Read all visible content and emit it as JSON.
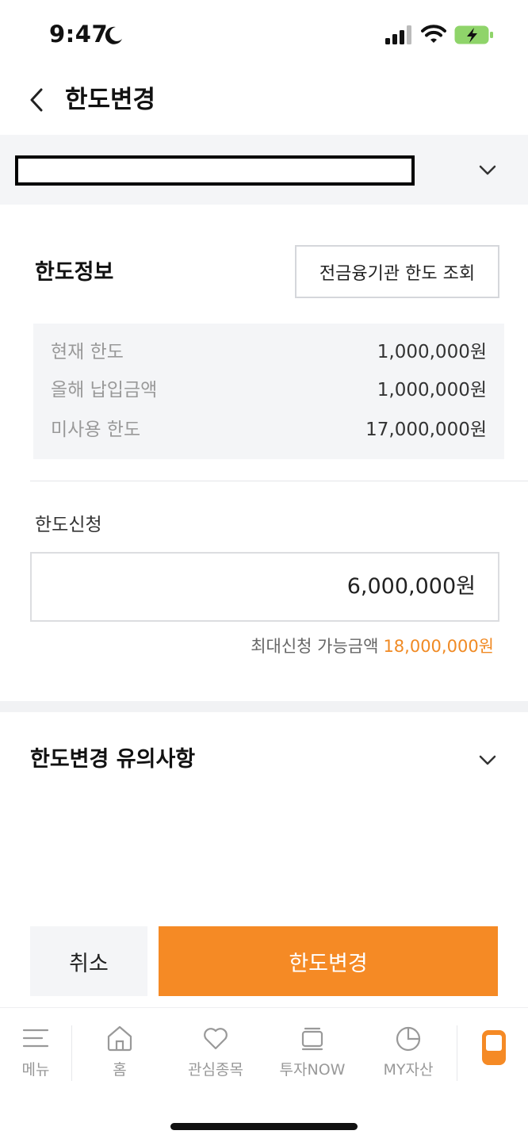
{
  "status_bar": {
    "time": "9:47"
  },
  "header": {
    "title": "한도변경"
  },
  "account": {
    "number": ""
  },
  "limit_info": {
    "title": "한도정보",
    "lookup_button": "전금융기관 한도 조회",
    "rows": [
      {
        "label": "현재 한도",
        "value": "1,000,000원"
      },
      {
        "label": "올해 납입금액",
        "value": "1,000,000원"
      },
      {
        "label": "미사용 한도",
        "value": "17,000,000원"
      }
    ]
  },
  "limit_request": {
    "label": "한도신청",
    "value": "6,000,000원",
    "max_label": "최대신청 가능금액",
    "max_value": "18,000,000원"
  },
  "notice": {
    "title": "한도변경 유의사항"
  },
  "actions": {
    "cancel": "취소",
    "confirm": "한도변경"
  },
  "tab_bar": {
    "items": [
      {
        "label": "메뉴",
        "icon": "hamburger-icon"
      },
      {
        "label": "홈",
        "icon": "home-icon"
      },
      {
        "label": "관심종목",
        "icon": "heart-icon"
      },
      {
        "label": "투자NOW",
        "icon": "stack-icon"
      },
      {
        "label": "MY자산",
        "icon": "pie-chart-icon"
      },
      {
        "label": "",
        "icon": "phone-icon"
      }
    ]
  },
  "colors": {
    "accent": "#f58a25",
    "accent_text": "#f08a24",
    "panel_bg": "#f4f5f7"
  }
}
